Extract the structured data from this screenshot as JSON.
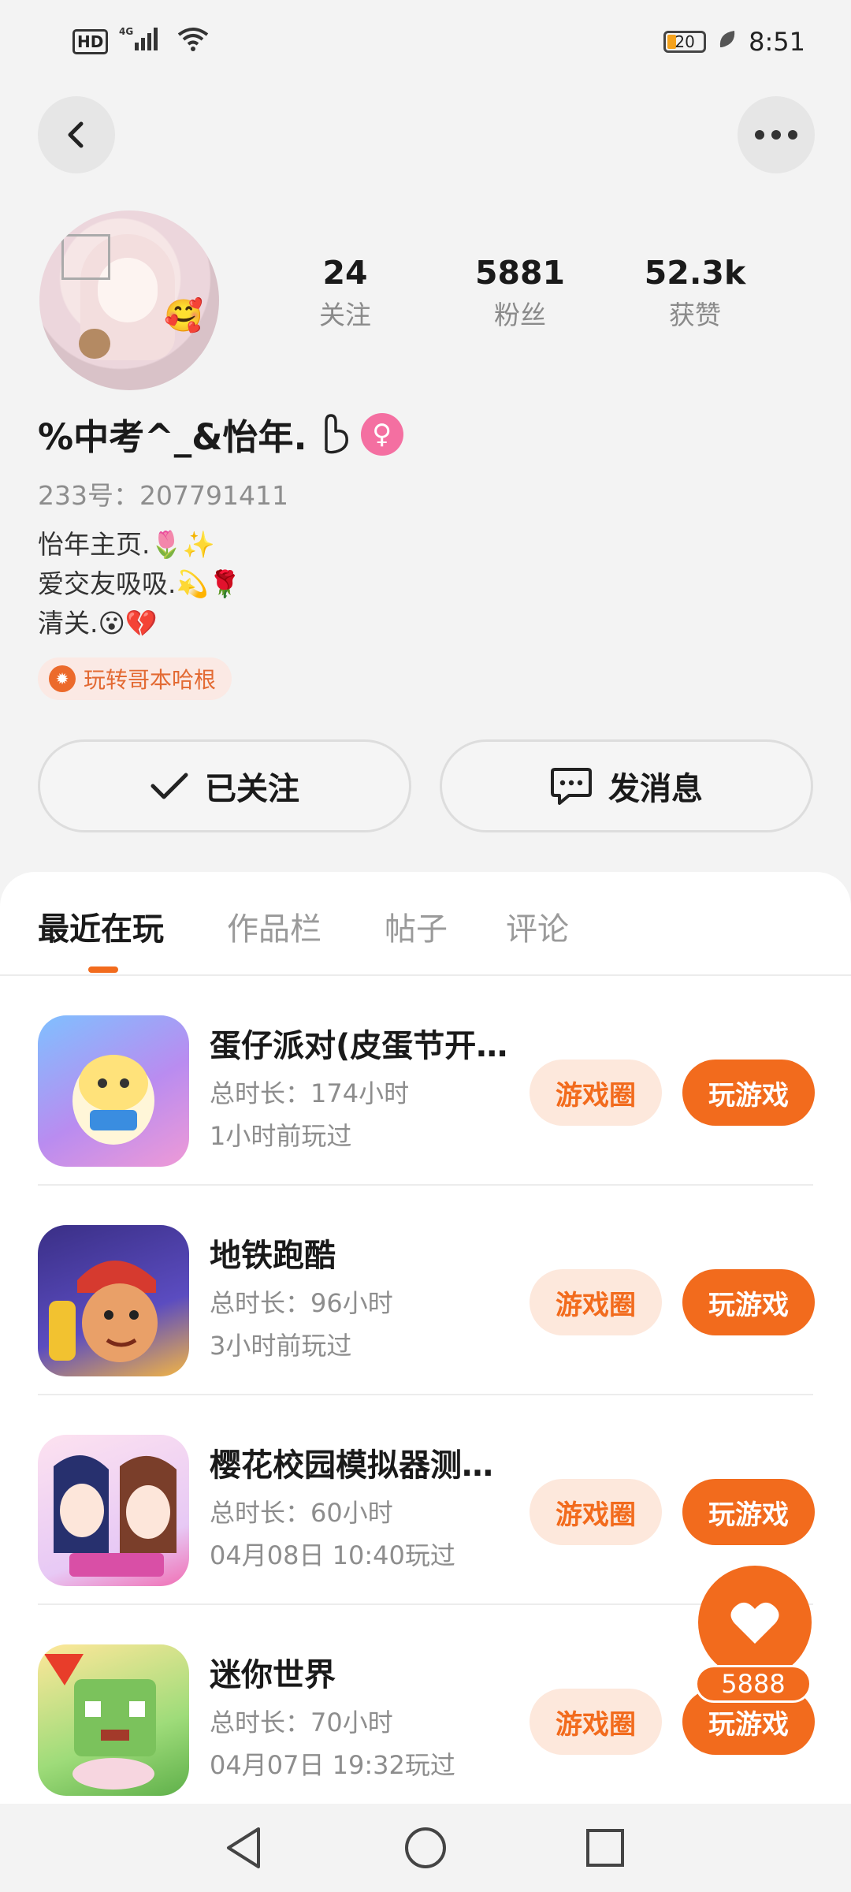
{
  "status_bar": {
    "hd": "HD",
    "network": "4G",
    "battery": "20",
    "time": "8:51"
  },
  "profile": {
    "nickname": "%中考^_&怡年.",
    "uid": "233号：207791411",
    "bio": "怡年主页.🌷✨\n爱交友吸吸.💫🌹\n清关.😮💔",
    "badge": "玩转哥本哈根",
    "avatar_emoji": "🥰"
  },
  "stats": [
    {
      "value": "24",
      "label": "关注"
    },
    {
      "value": "5881",
      "label": "粉丝"
    },
    {
      "value": "52.3k",
      "label": "获赞"
    }
  ],
  "actions": {
    "follow": "已关注",
    "message": "发消息"
  },
  "tabs": [
    "最近在玩",
    "作品栏",
    "帖子",
    "评论"
  ],
  "games": [
    {
      "title": "蛋仔派对(皮蛋节开…",
      "duration": "总时长：174小时",
      "last_played": "1小时前玩过",
      "circle_label": "游戏圈",
      "play_label": "玩游戏"
    },
    {
      "title": "地铁跑酷",
      "duration": "总时长：96小时",
      "last_played": "3小时前玩过",
      "circle_label": "游戏圈",
      "play_label": "玩游戏"
    },
    {
      "title": "樱花校园模拟器测…",
      "duration": "总时长：60小时",
      "last_played": "04月08日 10:40玩过",
      "circle_label": "游戏圈",
      "play_label": "玩游戏"
    },
    {
      "title": "迷你世界",
      "duration": "总时长：70小时",
      "last_played": "04月07日 19:32玩过",
      "circle_label": "游戏圈",
      "play_label": "玩游戏"
    }
  ],
  "fab": {
    "count": "5888"
  },
  "colors": {
    "accent": "#f26b1d",
    "accent_light": "#fde8dc",
    "background": "#f3f3f3"
  }
}
